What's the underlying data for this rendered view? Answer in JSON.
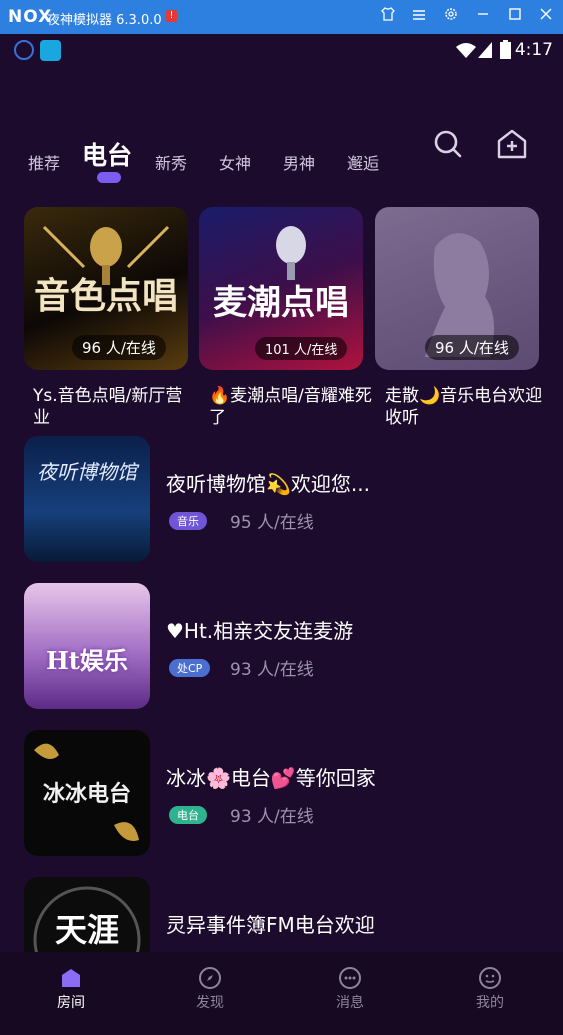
{
  "window": {
    "logo": "NOX",
    "title": "夜神模拟器 6.3.0.0",
    "warn": "!"
  },
  "status": {
    "time": "4:17"
  },
  "tabs": [
    {
      "label": "推荐"
    },
    {
      "label": "电台"
    },
    {
      "label": "新秀"
    },
    {
      "label": "女神"
    },
    {
      "label": "男神"
    },
    {
      "label": "邂逅"
    }
  ],
  "featured": [
    {
      "art_text": "音色点唱",
      "online": "96 人/在线",
      "title": "Ys.音色点唱/新厅营业"
    },
    {
      "art_text": "麦潮点唱",
      "online": "101 人/在线",
      "title": "🔥麦潮点唱/音耀难死了"
    },
    {
      "art_text": "",
      "online": "96 人/在线",
      "title": "走散🌙音乐电台欢迎收听"
    }
  ],
  "rooms": [
    {
      "title": "夜听博物馆💫欢迎您...",
      "tag": "音乐",
      "tag_color": "#6f56d6",
      "online": "95 人/在线",
      "art_text": "夜听博物馆"
    },
    {
      "title": "♥Ht.相亲交友连麦游",
      "tag": "处CP",
      "tag_color": "#4b6fd1",
      "online": "93 人/在线",
      "art_text": "Ht娱乐"
    },
    {
      "title": "冰冰🌸电台💕等你回家",
      "tag": "电台",
      "tag_color": "#2fb38e",
      "online": "93 人/在线",
      "art_text": "冰冰电台"
    },
    {
      "title": "灵异事件簿FM电台欢迎",
      "tag": "",
      "tag_color": "#2fb38e",
      "online": "",
      "art_text": "天涯"
    }
  ],
  "nav": [
    {
      "label": "房间",
      "icon": "room-icon"
    },
    {
      "label": "发现",
      "icon": "compass-icon"
    },
    {
      "label": "消息",
      "icon": "message-icon"
    },
    {
      "label": "我的",
      "icon": "profile-icon"
    }
  ],
  "colors": {
    "accent": "#7a5cf0",
    "background": "#1d0b2e",
    "titlebar": "#2d7fe0"
  }
}
